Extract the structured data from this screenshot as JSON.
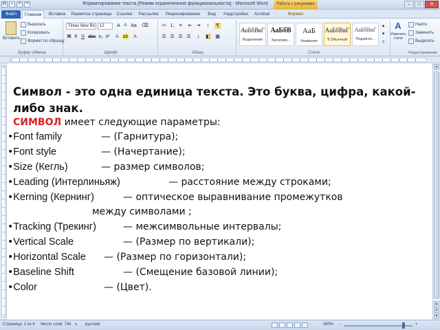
{
  "titlebar": {
    "title": "Форматирование текста [Режим ограниченной функциональности] - Microsoft Word",
    "context_tab_group": "Работа с рисунками"
  },
  "tabs": [
    {
      "label": "Файл"
    },
    {
      "label": "Главная"
    },
    {
      "label": "Вставка"
    },
    {
      "label": "Разметка страницы"
    },
    {
      "label": "Ссылки"
    },
    {
      "label": "Рассылки"
    },
    {
      "label": "Рецензирование"
    },
    {
      "label": "Вид"
    },
    {
      "label": "Надстройки"
    },
    {
      "label": "Acrobat"
    },
    {
      "label": "Формат"
    }
  ],
  "ribbon": {
    "clipboard": {
      "paste": "Вставить",
      "cut": "Вырезать",
      "copy": "Копировать",
      "format_painter": "Формат по образцу",
      "group": "Буфер обмена"
    },
    "font": {
      "font_name": "Times New Ro",
      "font_size": "12",
      "group": "Шрифт"
    },
    "paragraph": {
      "group": "Абзац"
    },
    "styles": {
      "items": [
        {
          "sample": "АаБбВвГ",
          "name": "Выделение"
        },
        {
          "sample": "АаБбВ",
          "name": "Заголово..."
        },
        {
          "sample": "АаБ",
          "name": "Название"
        },
        {
          "sample": "АаБбВвГ",
          "name": "¶ Обычный"
        },
        {
          "sample": "АаБбВвГ",
          "name": "Подзагол..."
        }
      ],
      "change_styles": "Изменить стили",
      "group": "Стили"
    },
    "editing": {
      "find": "Найти",
      "replace": "Заменить",
      "select": "Выделить",
      "group": "Редактирование"
    }
  },
  "document": {
    "heading_line1": "Символ - это одна единица текста. Это буква, цифра, какой-",
    "heading_line2": "либо знак.",
    "intro_keyword": "СИМВОЛ",
    "intro_rest": " имеет следующие параметры:",
    "params": [
      {
        "name": "Font family",
        "desc": "— (Гарнитура);"
      },
      {
        "name": "Font style",
        "desc": "— (Начертание);"
      },
      {
        "name": "Size (Кегль)",
        "desc": "— размер символов;"
      },
      {
        "name": "Leading (Интерлиньяж)",
        "desc": "— расстояние между строками;"
      },
      {
        "name": "Kerning (Кернинг)",
        "desc": "— оптическое выравнивание промежутков"
      },
      {
        "name": "",
        "desc": "между символами ;"
      },
      {
        "name": "Tracking (Трекинг)",
        "desc": "— межсимвольные интервалы;"
      },
      {
        "name": "Vertical Scale",
        "desc": "— (Размер по вертикали);"
      },
      {
        "name": "Horizontal Scale",
        "desc": "— (Размер по горизонтали);"
      },
      {
        "name": "Baseline Shift",
        "desc": "— (Смещение базовой линии);"
      },
      {
        "name": "Color",
        "desc": "— (Цвет)."
      }
    ],
    "bullet": "•"
  },
  "statusbar": {
    "page": "Страница: 2 из 4",
    "words": "Число слов: 748",
    "language": "русский",
    "zoom": "450%"
  }
}
